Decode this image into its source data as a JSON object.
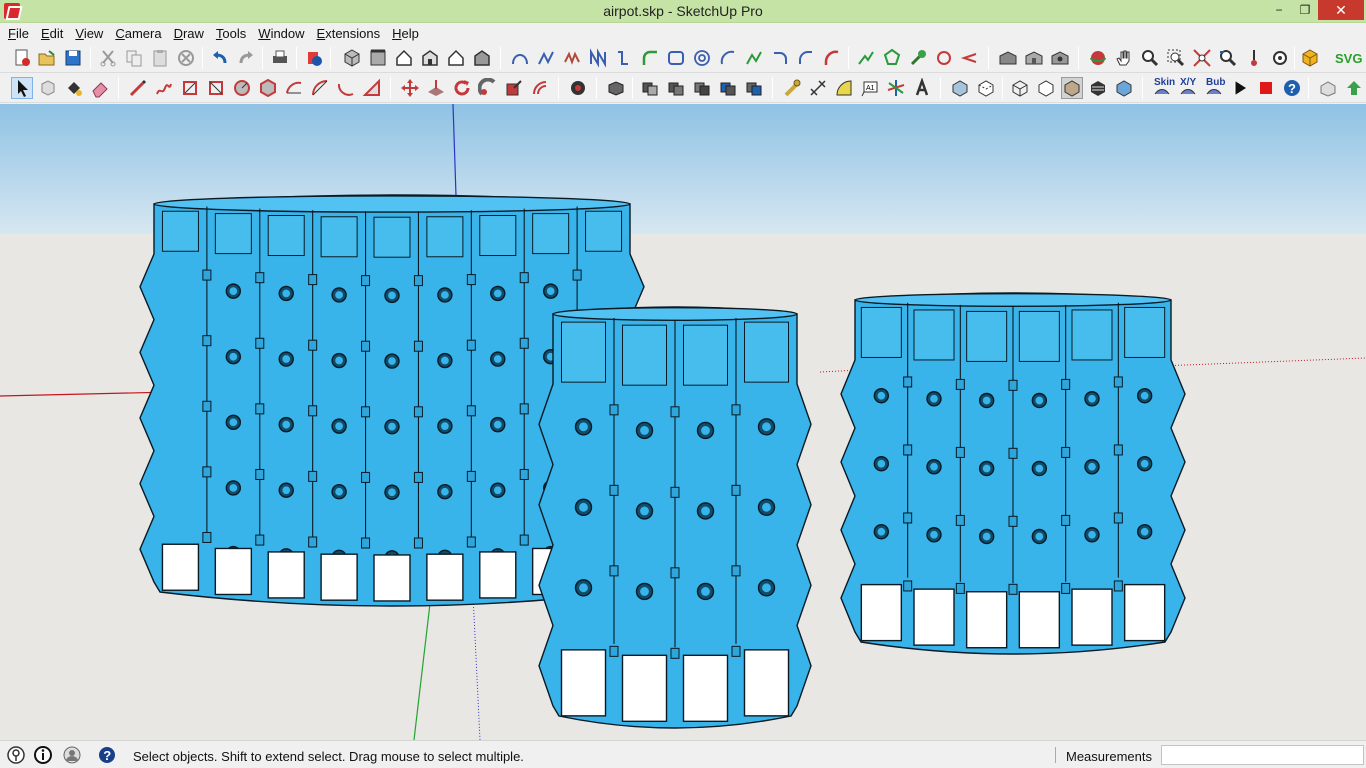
{
  "window": {
    "title": "airpot.skp - SketchUp Pro",
    "minimize_glyph": "−",
    "maximize_glyph": "❐",
    "close_glyph": "✕"
  },
  "menu": [
    {
      "label": "File",
      "accel": "F",
      "rest": "ile"
    },
    {
      "label": "Edit",
      "accel": "E",
      "rest": "dit"
    },
    {
      "label": "View",
      "accel": "V",
      "rest": "iew"
    },
    {
      "label": "Camera",
      "accel": "C",
      "rest": "amera"
    },
    {
      "label": "Draw",
      "accel": "D",
      "rest": "raw"
    },
    {
      "label": "Tools",
      "accel": "T",
      "rest": "ools"
    },
    {
      "label": "Window",
      "accel": "W",
      "rest": "indow"
    },
    {
      "label": "Extensions",
      "accel": "E",
      "rest": "xtensions"
    },
    {
      "label": "Help",
      "accel": "H",
      "rest": "elp"
    }
  ],
  "toolbar2_text": {
    "skin": "Skin",
    "xy": "X/Y",
    "bub": "Bub",
    "svg": "SVG"
  },
  "colors": {
    "model_fill": "#38b4ea",
    "model_stroke": "#0a1a24",
    "sky_top": "#93c5e6",
    "ground": "#e8e7e4",
    "axis_red": "#c4151c",
    "axis_green": "#22a531",
    "axis_blue": "#2b34c8"
  },
  "status": {
    "hint": "Select objects. Shift to extend select. Drag mouse to select multiple.",
    "measurements_label": "Measurements",
    "measurements_value": ""
  }
}
